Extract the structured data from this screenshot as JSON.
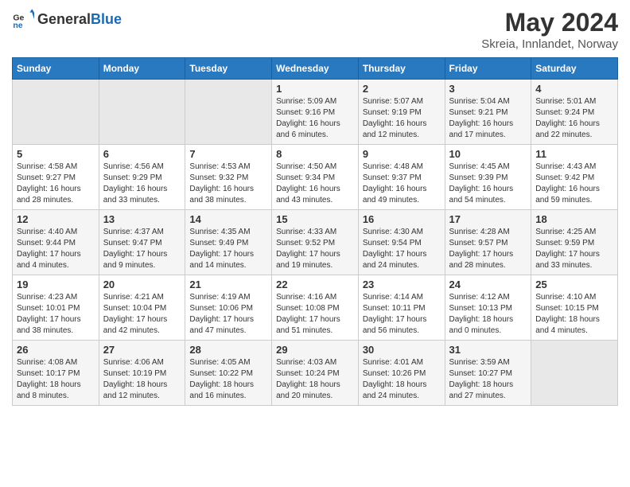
{
  "header": {
    "logo_general": "General",
    "logo_blue": "Blue",
    "month_year": "May 2024",
    "location": "Skreia, Innlandet, Norway"
  },
  "weekdays": [
    "Sunday",
    "Monday",
    "Tuesday",
    "Wednesday",
    "Thursday",
    "Friday",
    "Saturday"
  ],
  "weeks": [
    [
      {
        "day": null,
        "info": ""
      },
      {
        "day": null,
        "info": ""
      },
      {
        "day": null,
        "info": ""
      },
      {
        "day": "1",
        "info": "Sunrise: 5:09 AM\nSunset: 9:16 PM\nDaylight: 16 hours\nand 6 minutes."
      },
      {
        "day": "2",
        "info": "Sunrise: 5:07 AM\nSunset: 9:19 PM\nDaylight: 16 hours\nand 12 minutes."
      },
      {
        "day": "3",
        "info": "Sunrise: 5:04 AM\nSunset: 9:21 PM\nDaylight: 16 hours\nand 17 minutes."
      },
      {
        "day": "4",
        "info": "Sunrise: 5:01 AM\nSunset: 9:24 PM\nDaylight: 16 hours\nand 22 minutes."
      }
    ],
    [
      {
        "day": "5",
        "info": "Sunrise: 4:58 AM\nSunset: 9:27 PM\nDaylight: 16 hours\nand 28 minutes."
      },
      {
        "day": "6",
        "info": "Sunrise: 4:56 AM\nSunset: 9:29 PM\nDaylight: 16 hours\nand 33 minutes."
      },
      {
        "day": "7",
        "info": "Sunrise: 4:53 AM\nSunset: 9:32 PM\nDaylight: 16 hours\nand 38 minutes."
      },
      {
        "day": "8",
        "info": "Sunrise: 4:50 AM\nSunset: 9:34 PM\nDaylight: 16 hours\nand 43 minutes."
      },
      {
        "day": "9",
        "info": "Sunrise: 4:48 AM\nSunset: 9:37 PM\nDaylight: 16 hours\nand 49 minutes."
      },
      {
        "day": "10",
        "info": "Sunrise: 4:45 AM\nSunset: 9:39 PM\nDaylight: 16 hours\nand 54 minutes."
      },
      {
        "day": "11",
        "info": "Sunrise: 4:43 AM\nSunset: 9:42 PM\nDaylight: 16 hours\nand 59 minutes."
      }
    ],
    [
      {
        "day": "12",
        "info": "Sunrise: 4:40 AM\nSunset: 9:44 PM\nDaylight: 17 hours\nand 4 minutes."
      },
      {
        "day": "13",
        "info": "Sunrise: 4:37 AM\nSunset: 9:47 PM\nDaylight: 17 hours\nand 9 minutes."
      },
      {
        "day": "14",
        "info": "Sunrise: 4:35 AM\nSunset: 9:49 PM\nDaylight: 17 hours\nand 14 minutes."
      },
      {
        "day": "15",
        "info": "Sunrise: 4:33 AM\nSunset: 9:52 PM\nDaylight: 17 hours\nand 19 minutes."
      },
      {
        "day": "16",
        "info": "Sunrise: 4:30 AM\nSunset: 9:54 PM\nDaylight: 17 hours\nand 24 minutes."
      },
      {
        "day": "17",
        "info": "Sunrise: 4:28 AM\nSunset: 9:57 PM\nDaylight: 17 hours\nand 28 minutes."
      },
      {
        "day": "18",
        "info": "Sunrise: 4:25 AM\nSunset: 9:59 PM\nDaylight: 17 hours\nand 33 minutes."
      }
    ],
    [
      {
        "day": "19",
        "info": "Sunrise: 4:23 AM\nSunset: 10:01 PM\nDaylight: 17 hours\nand 38 minutes."
      },
      {
        "day": "20",
        "info": "Sunrise: 4:21 AM\nSunset: 10:04 PM\nDaylight: 17 hours\nand 42 minutes."
      },
      {
        "day": "21",
        "info": "Sunrise: 4:19 AM\nSunset: 10:06 PM\nDaylight: 17 hours\nand 47 minutes."
      },
      {
        "day": "22",
        "info": "Sunrise: 4:16 AM\nSunset: 10:08 PM\nDaylight: 17 hours\nand 51 minutes."
      },
      {
        "day": "23",
        "info": "Sunrise: 4:14 AM\nSunset: 10:11 PM\nDaylight: 17 hours\nand 56 minutes."
      },
      {
        "day": "24",
        "info": "Sunrise: 4:12 AM\nSunset: 10:13 PM\nDaylight: 18 hours\nand 0 minutes."
      },
      {
        "day": "25",
        "info": "Sunrise: 4:10 AM\nSunset: 10:15 PM\nDaylight: 18 hours\nand 4 minutes."
      }
    ],
    [
      {
        "day": "26",
        "info": "Sunrise: 4:08 AM\nSunset: 10:17 PM\nDaylight: 18 hours\nand 8 minutes."
      },
      {
        "day": "27",
        "info": "Sunrise: 4:06 AM\nSunset: 10:19 PM\nDaylight: 18 hours\nand 12 minutes."
      },
      {
        "day": "28",
        "info": "Sunrise: 4:05 AM\nSunset: 10:22 PM\nDaylight: 18 hours\nand 16 minutes."
      },
      {
        "day": "29",
        "info": "Sunrise: 4:03 AM\nSunset: 10:24 PM\nDaylight: 18 hours\nand 20 minutes."
      },
      {
        "day": "30",
        "info": "Sunrise: 4:01 AM\nSunset: 10:26 PM\nDaylight: 18 hours\nand 24 minutes."
      },
      {
        "day": "31",
        "info": "Sunrise: 3:59 AM\nSunset: 10:27 PM\nDaylight: 18 hours\nand 27 minutes."
      },
      {
        "day": null,
        "info": ""
      }
    ]
  ]
}
